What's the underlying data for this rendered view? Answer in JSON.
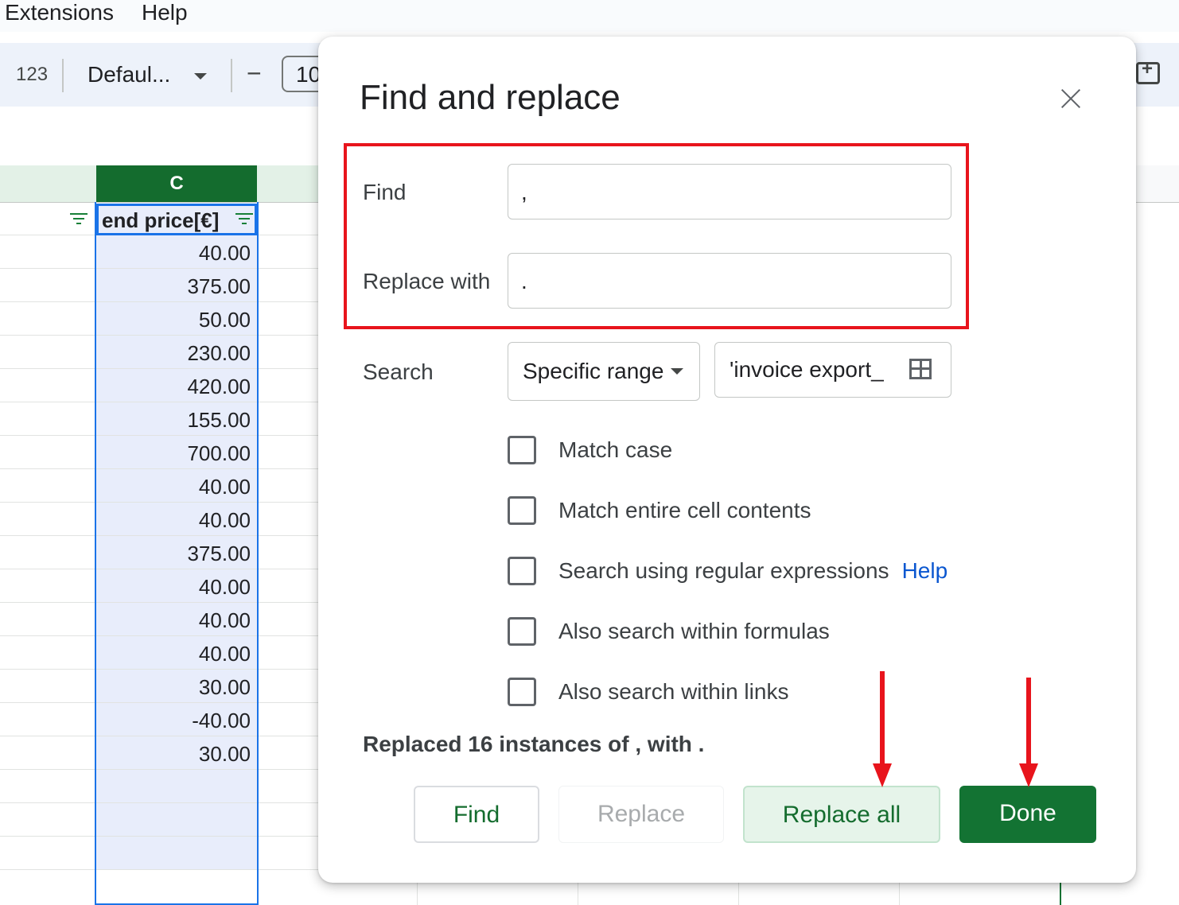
{
  "menu": {
    "items": [
      "Extensions",
      "Help"
    ]
  },
  "toolbar": {
    "format_number": "123",
    "font_name": "Defaul...",
    "decrease_symbol": "−",
    "font_size": "10"
  },
  "sheet": {
    "column_label": "C",
    "header_cell": "end price[€]",
    "values": [
      "40.00",
      "375.00",
      "50.00",
      "230.00",
      "420.00",
      "155.00",
      "700.00",
      "40.00",
      "40.00",
      "375.00",
      "40.00",
      "40.00",
      "40.00",
      "30.00",
      "-40.00",
      "30.00",
      "",
      "",
      ""
    ]
  },
  "dialog": {
    "title": "Find and replace",
    "find_label": "Find",
    "find_value": ",",
    "replace_label": "Replace with",
    "replace_value": ".",
    "search_label": "Search",
    "search_scope": "Specific range",
    "range_value": "'invoice export_",
    "options": [
      {
        "label": "Match case",
        "checked": false
      },
      {
        "label": "Match entire cell contents",
        "checked": false
      },
      {
        "label": "Search using regular expressions",
        "checked": false
      },
      {
        "label": "Also search within formulas",
        "checked": false
      },
      {
        "label": "Also search within links",
        "checked": false
      }
    ],
    "help_link": "Help",
    "status": "Replaced 16 instances of , with .",
    "buttons": {
      "find": "Find",
      "replace": "Replace",
      "replace_all": "Replace all",
      "done": "Done"
    }
  },
  "colors": {
    "accent_green": "#137333",
    "highlight_red": "#e8141c",
    "link_blue": "#0b57d0",
    "selection_blue": "#1a73e8"
  }
}
